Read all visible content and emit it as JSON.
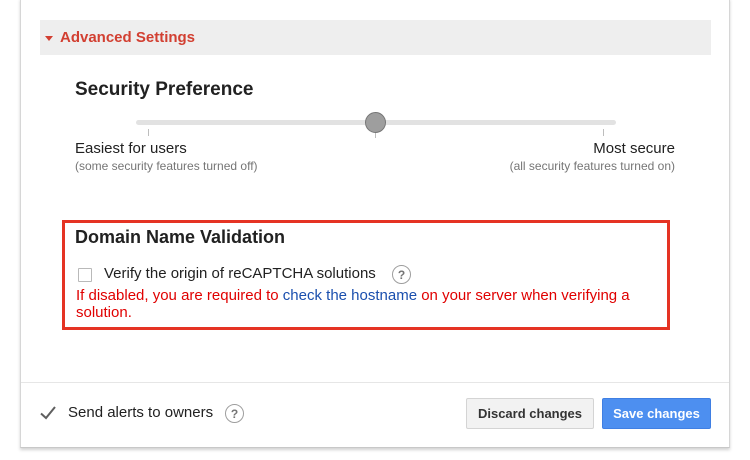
{
  "advanced_settings": {
    "label": "Advanced Settings",
    "expanded": true,
    "color": "#d23f31"
  },
  "security_preference": {
    "title": "Security Preference",
    "slider_level": 0.5,
    "min_label": "Easiest for users",
    "min_sublabel": "(some security features turned off)",
    "max_label": "Most secure",
    "max_sublabel": "(all security features turned on)"
  },
  "domain_validation": {
    "title": "Domain Name Validation",
    "checkbox_label": "Verify the origin of reCAPTCHA solutions",
    "checked": false,
    "help_glyph": "?",
    "warning_before": "If disabled, you are required to ",
    "warning_link": "check the hostname",
    "warning_after": " on your server when verifying a solution.",
    "highlight_color": "#e53323",
    "warning_color": "#e00000"
  },
  "footer": {
    "alerts_label": "Send alerts to owners",
    "alerts_checked": true,
    "help_glyph": "?",
    "discard_label": "Discard changes",
    "save_label": "Save changes",
    "save_color": "#4d8ff0"
  }
}
